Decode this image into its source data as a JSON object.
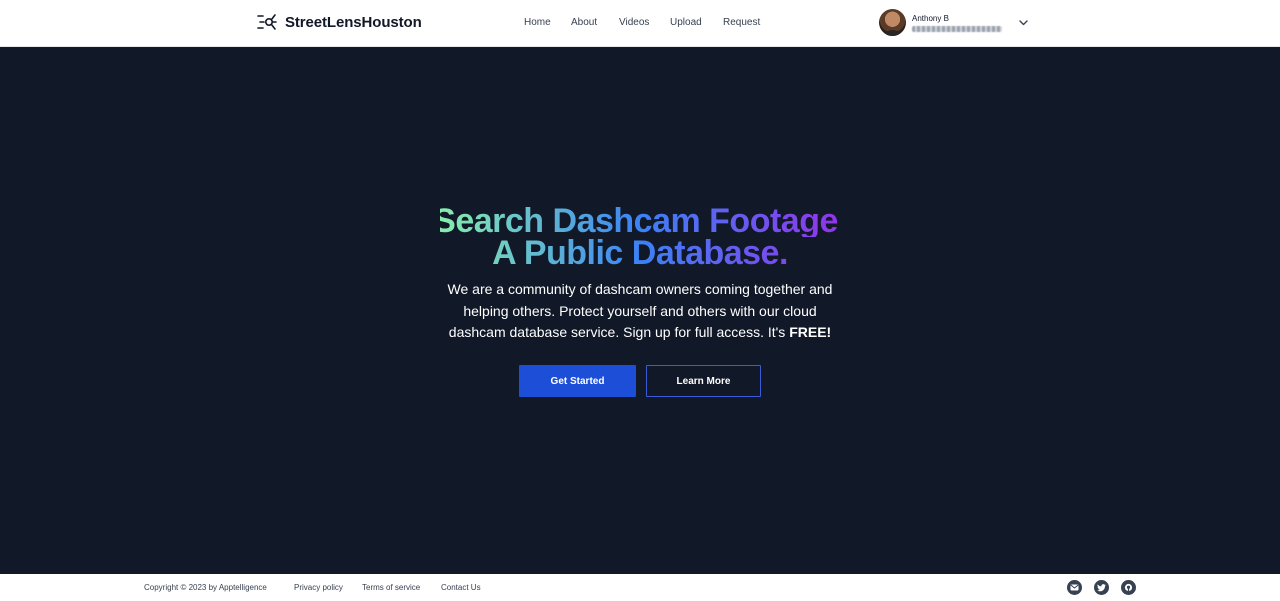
{
  "header": {
    "brand": "StreetLensHouston",
    "nav": [
      "Home",
      "About",
      "Videos",
      "Upload",
      "Request"
    ],
    "user": {
      "name": "Anthony B"
    }
  },
  "hero": {
    "title_line1": "Search Dashcam Footage.",
    "title_line2": "A Public Database.",
    "subtitle": "We are a community of dashcam owners coming together and helping others. Protect yourself and others with our cloud dashcam database service. Sign up for full access. It's",
    "subtitle_emphasis": "FREE!",
    "primary_button": "Get Started",
    "secondary_button": "Learn More"
  },
  "footer": {
    "copyright": "Copyright © 2023 by Apptelligence",
    "links": [
      "Privacy policy",
      "Terms of service",
      "Contact Us"
    ],
    "social_icons": [
      "mail-icon",
      "twitter-icon",
      "github-icon"
    ]
  },
  "colors": {
    "header_bg": "#ffffff",
    "hero_bg": "#111827",
    "primary": "#1d4ed8",
    "gradient": [
      "#86efac",
      "#3b82f6",
      "#9333ea"
    ]
  }
}
